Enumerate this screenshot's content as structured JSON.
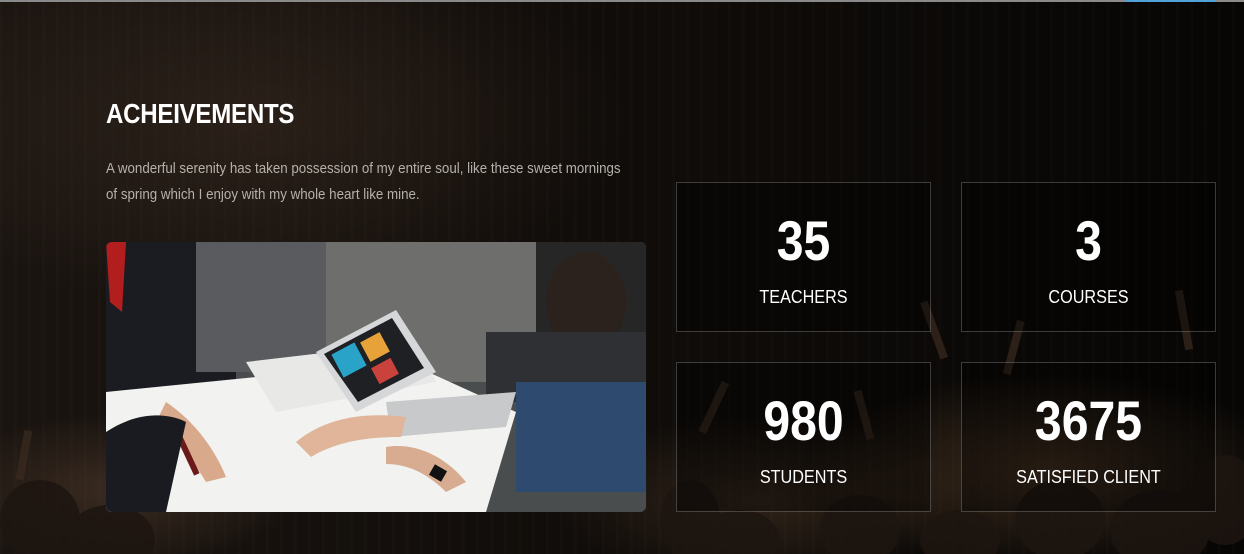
{
  "colors": {
    "background": "#0b0908",
    "heading": "#ffffff",
    "text": "#b5b0aa",
    "box_border": "#3a3a3a",
    "accent_line": "#4fa3d9"
  },
  "section": {
    "title": "ACHEIVEMENTS",
    "description": "A wonderful serenity has taken possession of my entire soul, like these sweet mornings of spring which I enjoy with my whole heart like mine."
  },
  "stats": [
    {
      "number": "35",
      "label": "TEACHERS"
    },
    {
      "number": "3",
      "label": "COURSES"
    },
    {
      "number": "980",
      "label": "STUDENTS"
    },
    {
      "number": "3675",
      "label": "SATISFIED CLIENT"
    }
  ]
}
